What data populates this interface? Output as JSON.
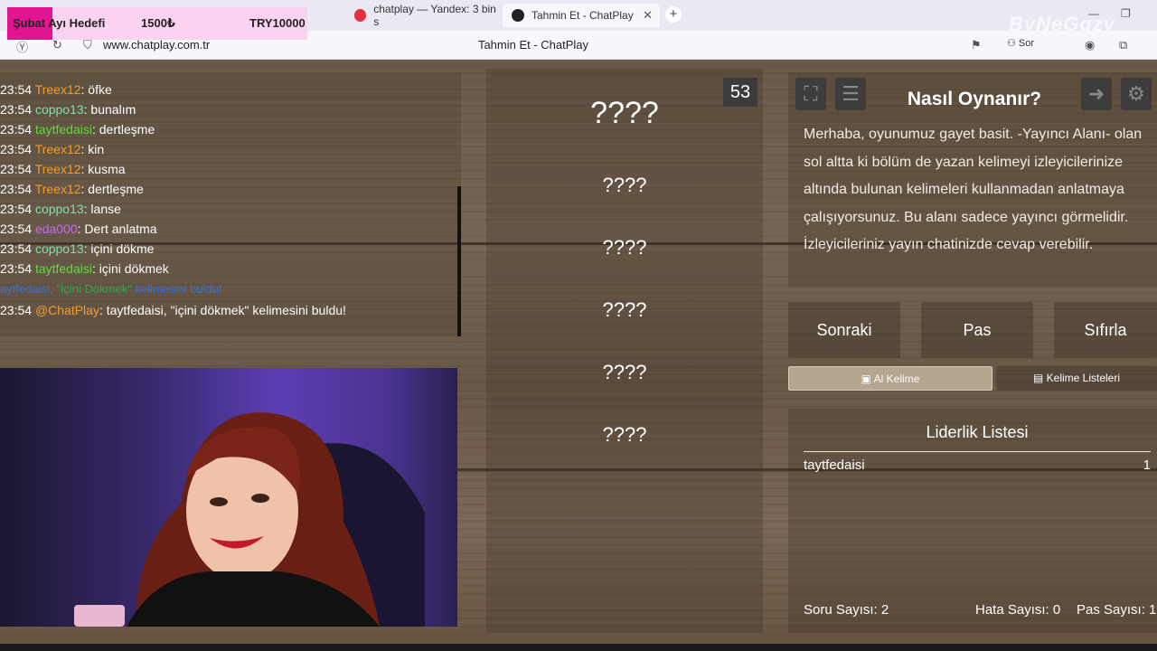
{
  "browser": {
    "tabs": [
      {
        "title": "chatplay — Yandex: 3 bin s"
      },
      {
        "title": "Tahmin Et - ChatPlay"
      }
    ],
    "url": "www.chatplay.com.tr",
    "page_title": "Tahmin Et - ChatPlay",
    "sor_label": "Sor",
    "watermark": "ByNeGgzy"
  },
  "donation": {
    "label": "Şubat Ayı Hedefi",
    "amount": "1500₺",
    "goal": "TRY10000"
  },
  "chat": {
    "messages": [
      {
        "time": "23:54",
        "user": "Treex12",
        "color": "#f39c2a",
        "text": ": öfke"
      },
      {
        "time": "23:54",
        "user": "coppo13",
        "color": "#7fe0a8",
        "text": ": bunalım"
      },
      {
        "time": "23:54",
        "user": "taytfedaisi",
        "color": "#5fdc3e",
        "text": ": dertleşme"
      },
      {
        "time": "23:54",
        "user": "Treex12",
        "color": "#f39c2a",
        "text": ": kin"
      },
      {
        "time": "23:54",
        "user": "Treex12",
        "color": "#f39c2a",
        "text": ": kusma"
      },
      {
        "time": "23:54",
        "user": "Treex12",
        "color": "#f39c2a",
        "text": ": dertleşme"
      },
      {
        "time": "23:54",
        "user": "coppo13",
        "color": "#7fe0a8",
        "text": ": lanse"
      },
      {
        "time": "23:54",
        "user": "eda000",
        "color": "#c06ae8",
        "text": ": Dert anlatma"
      },
      {
        "time": "23:54",
        "user": "coppo13",
        "color": "#7fe0a8",
        "text": ": içini dökme"
      },
      {
        "time": "23:54",
        "user": "taytfedaisi",
        "color": "#5fdc3e",
        "text": ": içini dökmek"
      }
    ],
    "system": {
      "user": "aytfedaisi,",
      "word": "\"İçini Dökmek\"",
      "text": "kelimesini buldu!"
    },
    "bot": {
      "time": "23:54",
      "user": "@ChatPlay",
      "text": ": taytfedaisi, \"içini dökmek\" kelimesini buldu!"
    }
  },
  "game": {
    "timer": "53",
    "main_word": "????",
    "forbidden_words": [
      "????",
      "????",
      "????",
      "????",
      "????"
    ]
  },
  "howto": {
    "title": "Nasıl Oynanır?",
    "text": "Merhaba, oyunumuz gayet basit. -Yayıncı Alanı- olan sol altta ki bölüm de yazan kelimeyi izleyicilerinize altında bulunan kelimeleri kullanmadan anlatmaya çalışıyorsunuz. Bu alanı sadece yayıncı görmelidir. İzleyicileriniz yayın chatinizde cevap verebilir."
  },
  "controls": {
    "next": "Sonraki",
    "pass": "Pas",
    "reset": "Sıfırla",
    "get_word": "Al Kelime",
    "word_lists": "Kelime Listeleri"
  },
  "leaderboard": {
    "title": "Liderlik Listesi",
    "rows": [
      {
        "name": "taytfedaisi",
        "score": "1"
      }
    ]
  },
  "stats": {
    "questions": "Soru Sayısı: 2",
    "errors": "Hata Sayısı: 0",
    "passes": "Pas Sayısı: 1"
  },
  "colors": {
    "donation_pink": "#e0158f",
    "link_blue": "#3a6fd8",
    "bot_orange": "#f39c2a"
  }
}
